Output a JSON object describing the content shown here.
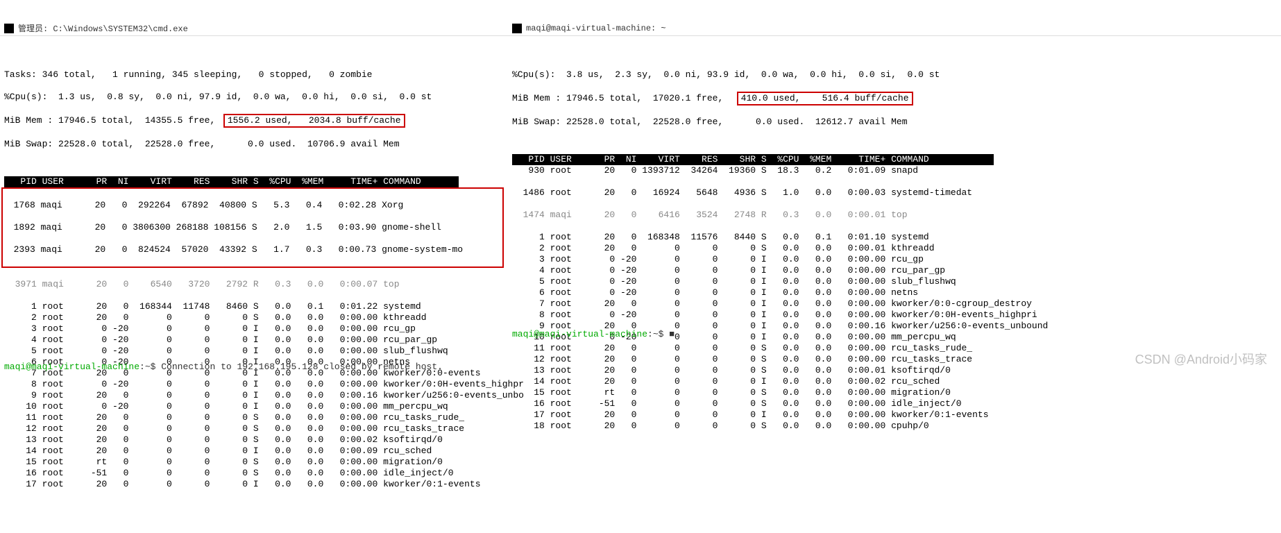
{
  "left": {
    "title": "管理员: C:\\Windows\\SYSTEM32\\cmd.exe",
    "tasks": "Tasks: 346 total,   1 running, 345 sleeping,   0 stopped,   0 zombie",
    "cpu": "%Cpu(s):  1.3 us,  0.8 sy,  0.0 ni, 97.9 id,  0.0 wa,  0.0 hi,  0.0 si,  0.0 st",
    "mem_a": "MiB Mem : 17946.5 total,  14355.5 free,  ",
    "mem_b": "1556.2 used,   2034.8 buff/cache",
    "swap": "MiB Swap: 22528.0 total,  22528.0 free,      0.0 used.  10706.9 avail Mem",
    "header": "   PID USER      PR  NI    VIRT    RES    SHR S  %CPU  %MEM     TIME+ COMMAND       ",
    "hl": [
      "  1768 maqi      20   0  292264  67892  40800 S   5.3   0.4   0:02.28 Xorg",
      "  1892 maqi      20   0 3806300 268188 108156 S   2.0   1.5   0:03.90 gnome-shell",
      "  2393 maqi      20   0  824524  57020  43392 S   1.7   0.3   0:00.73 gnome-system-mo"
    ],
    "dim": "  3971 maqi      20   0    6540   3720   2792 R   0.3   0.0   0:00.07 top",
    "rows": [
      "     1 root      20   0  168344  11748   8460 S   0.0   0.1   0:01.22 systemd",
      "     2 root      20   0       0      0      0 S   0.0   0.0   0:00.00 kthreadd",
      "     3 root       0 -20       0      0      0 I   0.0   0.0   0:00.00 rcu_gp",
      "     4 root       0 -20       0      0      0 I   0.0   0.0   0:00.00 rcu_par_gp",
      "     5 root       0 -20       0      0      0 I   0.0   0.0   0:00.00 slub_flushwq",
      "     6 root       0 -20       0      0      0 I   0.0   0.0   0:00.00 netns",
      "     7 root      20   0       0      0      0 I   0.0   0.0   0:00.00 kworker/0:0-events",
      "     8 root       0 -20       0      0      0 I   0.0   0.0   0:00.00 kworker/0:0H-events_highpr",
      "     9 root      20   0       0      0      0 I   0.0   0.0   0:00.16 kworker/u256:0-events_unbo",
      "    10 root       0 -20       0      0      0 I   0.0   0.0   0:00.00 mm_percpu_wq",
      "    11 root      20   0       0      0      0 S   0.0   0.0   0:00.00 rcu_tasks_rude_",
      "    12 root      20   0       0      0      0 S   0.0   0.0   0:00.00 rcu_tasks_trace",
      "    13 root      20   0       0      0      0 S   0.0   0.0   0:00.02 ksoftirqd/0",
      "    14 root      20   0       0      0      0 I   0.0   0.0   0:00.09 rcu_sched",
      "    15 root      rt   0       0      0      0 S   0.0   0.0   0:00.00 migration/0",
      "    16 root     -51   0       0      0      0 S   0.0   0.0   0:00.00 idle_inject/0",
      "    17 root      20   0       0      0      0 I   0.0   0.0   0:00.00 kworker/0:1-events"
    ],
    "footer_prompt": "maqi@maqi-virtual-machine",
    "footer_rest": ":~$ Connection to 192.168.195.128 closed by remote host."
  },
  "right": {
    "title": "maqi@maqi-virtual-machine: ~",
    "cpu": "%Cpu(s):  3.8 us,  2.3 sy,  0.0 ni, 93.9 id,  0.0 wa,  0.0 hi,  0.0 si,  0.0 st",
    "mem_a": "MiB Mem : 17946.5 total,  17020.1 free,   ",
    "mem_b": "410.0 used,    516.4 buff/cache",
    "swap": "MiB Swap: 22528.0 total,  22528.0 free,      0.0 used.  12612.7 avail Mem",
    "header": "   PID USER      PR  NI    VIRT    RES    SHR S  %CPU  %MEM     TIME+ COMMAND            ",
    "rows1": [
      "   930 root      20   0 1393712  34264  19360 S  18.3   0.2   0:01.09 snapd",
      "  1486 root      20   0   16924   5648   4936 S   1.0   0.0   0:00.03 systemd-timedat"
    ],
    "dim": "  1474 maqi      20   0    6416   3524   2748 R   0.3   0.0   0:00.01 top",
    "rows2": [
      "     1 root      20   0  168348  11576   8440 S   0.0   0.1   0:01.10 systemd",
      "     2 root      20   0       0      0      0 S   0.0   0.0   0:00.01 kthreadd",
      "     3 root       0 -20       0      0      0 I   0.0   0.0   0:00.00 rcu_gp",
      "     4 root       0 -20       0      0      0 I   0.0   0.0   0:00.00 rcu_par_gp",
      "     5 root       0 -20       0      0      0 I   0.0   0.0   0:00.00 slub_flushwq",
      "     6 root       0 -20       0      0      0 I   0.0   0.0   0:00.00 netns",
      "     7 root      20   0       0      0      0 I   0.0   0.0   0:00.00 kworker/0:0-cgroup_destroy",
      "     8 root       0 -20       0      0      0 I   0.0   0.0   0:00.00 kworker/0:0H-events_highpri",
      "     9 root      20   0       0      0      0 I   0.0   0.0   0:00.16 kworker/u256:0-events_unbound",
      "    10 root       0 -20       0      0      0 I   0.0   0.0   0:00.00 mm_percpu_wq",
      "    11 root      20   0       0      0      0 S   0.0   0.0   0:00.00 rcu_tasks_rude_",
      "    12 root      20   0       0      0      0 S   0.0   0.0   0:00.00 rcu_tasks_trace",
      "    13 root      20   0       0      0      0 S   0.0   0.0   0:00.01 ksoftirqd/0",
      "    14 root      20   0       0      0      0 I   0.0   0.0   0:00.02 rcu_sched",
      "    15 root      rt   0       0      0      0 S   0.0   0.0   0:00.00 migration/0",
      "    16 root     -51   0       0      0      0 S   0.0   0.0   0:00.00 idle_inject/0",
      "    17 root      20   0       0      0      0 I   0.0   0.0   0:00.00 kworker/0:1-events",
      "    18 root      20   0       0      0      0 S   0.0   0.0   0:00.00 cpuhp/0"
    ],
    "footer_prompt": "maqi@maqi-virtual-machine",
    "footer_rest": ":~$ ■"
  },
  "watermark": "CSDN @Android小码家"
}
